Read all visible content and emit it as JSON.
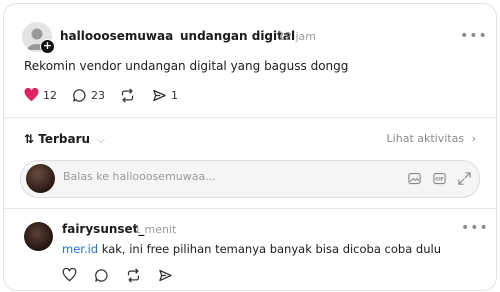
{
  "post": {
    "username": "hallooosemuwaa",
    "topic": "undangan digital",
    "timestamp": "12 jam",
    "text": "Rekomin vendor undangan digital yang baguss dongg",
    "likes": "12",
    "replies": "23",
    "shares": "1"
  },
  "thread": {
    "sort_label": "Terbaru",
    "activity_link": "Lihat aktivitas"
  },
  "reply_box": {
    "placeholder": "Balas ke hallooosemuwaa..."
  },
  "reply": {
    "username": "fairysunset_",
    "timestamp": "1 menit",
    "mention": "mer.id",
    "text": " kak, ini free pilihan temanya banyak bisa dicoba coba dulu"
  },
  "colors": {
    "like": "#e0245e",
    "mention": "#1e73d8"
  }
}
